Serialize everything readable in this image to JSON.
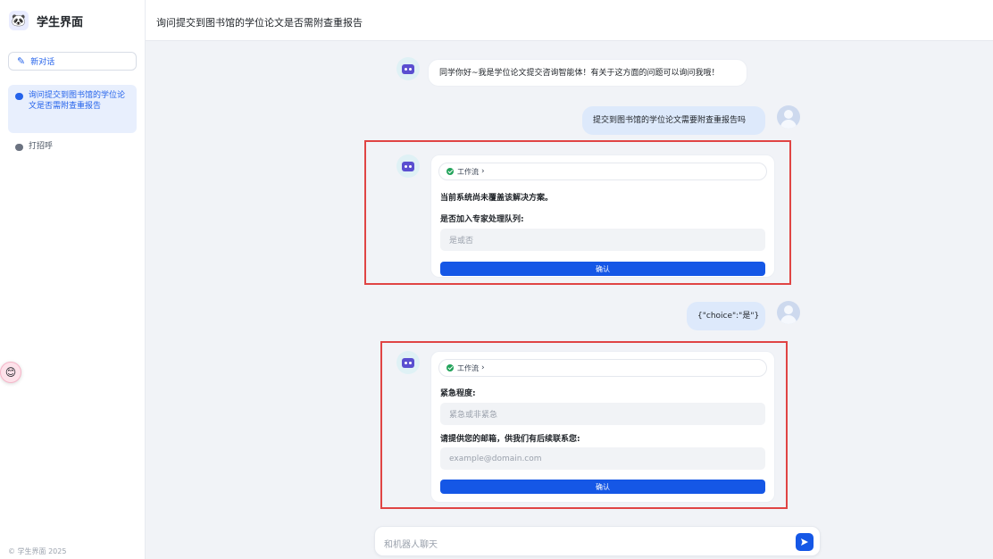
{
  "sidebar": {
    "brand_title": "学生界面",
    "new_chat_label": "新对话",
    "conversations": [
      {
        "title": "询问提交到图书馆的学位论文是否需附查重报告",
        "active": true
      },
      {
        "title": "打招呼",
        "active": false
      }
    ],
    "footer": "© 学生界面 2025"
  },
  "header": {
    "title": "询问提交到图书馆的学位论文是否需附查重报告"
  },
  "messages": {
    "bot_greeting": "同学你好~我是学位论文提交咨询智能体！有关于这方面的问题可以询问我哦！",
    "user_question": "提交到图书馆的学位论文需要附查重报告吗",
    "card1": {
      "workflow_label": "工作流",
      "notice": "当前系统尚未覆盖该解决方案。",
      "field_label": "是否加入专家处理队列:",
      "field_placeholder": "是或否",
      "confirm_label": "确认"
    },
    "user_choice": "{\"choice\":\"是\"}",
    "card2": {
      "workflow_label": "工作流",
      "field1_label": "紧急程度:",
      "field1_placeholder": "紧急或非紧急",
      "field2_label": "请提供您的邮箱，供我们有后续联系您:",
      "field2_placeholder": "example@domain.com",
      "confirm_label": "确认"
    }
  },
  "chat_input": {
    "placeholder": "和机器人聊天"
  },
  "icons": {
    "brand": "panda-logo-icon",
    "new_chat": "edit-icon",
    "send": "send-icon",
    "bot_avatar": "robot-icon",
    "user_avatar": "user-icon"
  },
  "colors": {
    "accent": "#1557e6",
    "highlight_box": "#e04444"
  }
}
